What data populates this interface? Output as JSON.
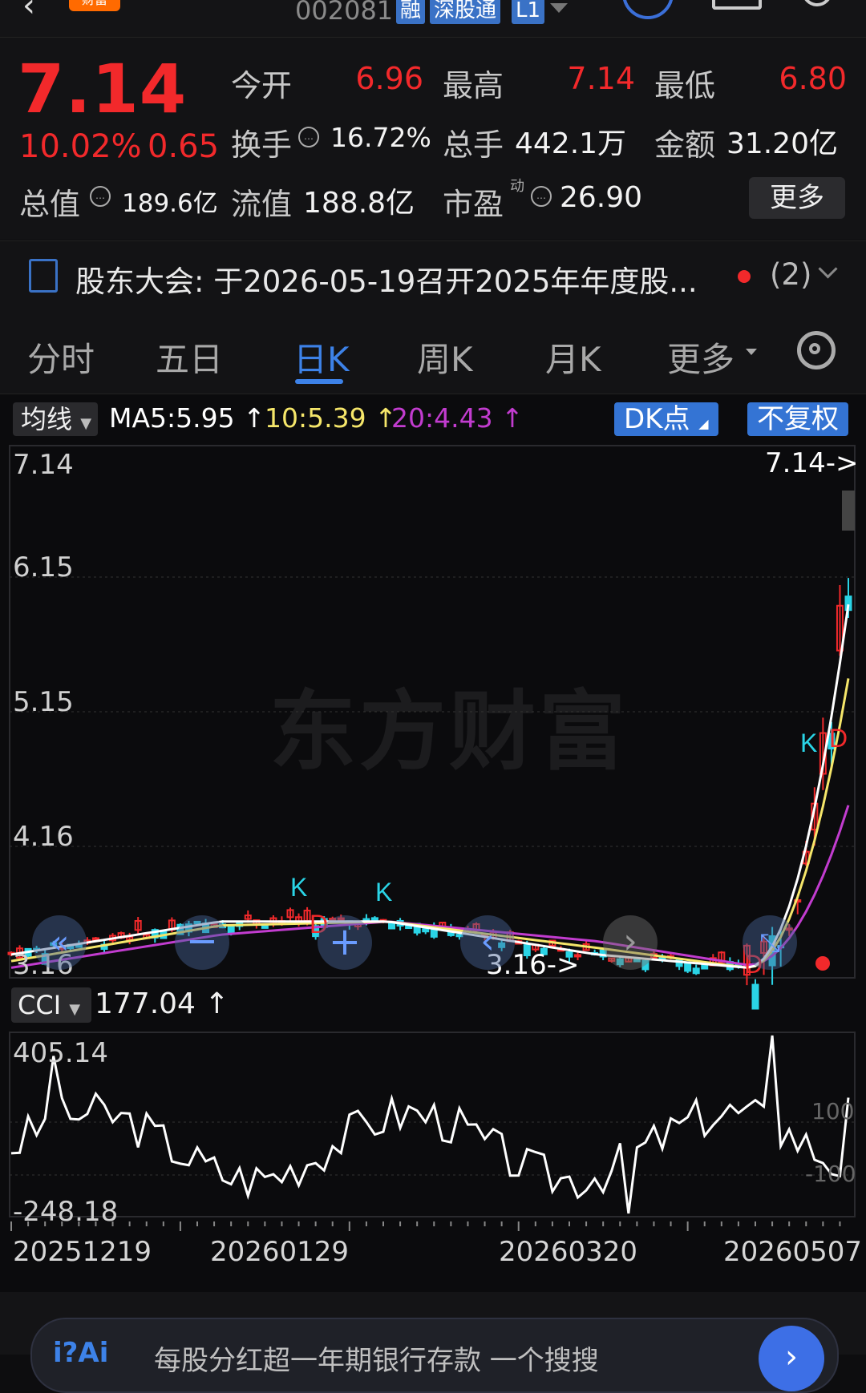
{
  "header": {
    "back": "‹",
    "logo": "财富",
    "code": "002081",
    "badges": [
      "融",
      "深股通",
      "L1"
    ]
  },
  "quote": {
    "price": "7.14",
    "change_pct": "10.02%",
    "change_amt": "0.65",
    "open_label": "今开",
    "open": "6.96",
    "high_label": "最高",
    "high": "7.14",
    "low_label": "最低",
    "low": "6.80",
    "turnover_label": "换手",
    "turnover": "16.72%",
    "volume_label": "总手",
    "volume": "442.1万",
    "amount_label": "金额",
    "amount": "31.20亿",
    "mktcap_label": "总值",
    "mktcap": "189.6亿",
    "float_label": "流值",
    "float": "188.8亿",
    "pe_label": "市盈",
    "pe_sup": "动",
    "pe": "26.90",
    "more": "更多"
  },
  "notice": {
    "text": "股东大会:  于2026-05-19召开2025年年度股...",
    "count": "(2)"
  },
  "tabs": [
    "分时",
    "五日",
    "日K",
    "周K",
    "月K",
    "更多"
  ],
  "chart": {
    "indicator_select": "均线",
    "ma5": "MA5:5.95",
    "ma10": "10:5.39",
    "ma20": "20:4.43",
    "dk_button": "DK点",
    "adjust_button": "不复权",
    "y_ticks": [
      "7.14",
      "6.15",
      "5.15",
      "4.16",
      "3.16"
    ],
    "high_marker": "7.14->",
    "low_marker": "3.16->",
    "watermark": "东方财富",
    "cci_select": "CCI",
    "cci_value": "177.04",
    "cci_ticks": [
      "405.14",
      "-248.18",
      "100",
      "-100"
    ],
    "dates": [
      "20251219",
      "20260129",
      "20260320",
      "20260507"
    ],
    "colors": {
      "up": "#f2292b",
      "down": "#2ad4e6",
      "ma5": "#ffffff",
      "ma10": "#f5e66a",
      "ma20": "#c23ccf"
    }
  },
  "bottom_bar": {
    "logo": "i?Ai",
    "text": "每股分红超一年期银行存款  一个搜搜"
  },
  "chart_data": {
    "type": "line",
    "title": "",
    "x": [
      "20251219",
      "20260129",
      "20260320",
      "20260507"
    ],
    "ylim": [
      3.16,
      7.14
    ],
    "series": [
      {
        "name": "MA5",
        "values": [
          3.3,
          3.55,
          3.55,
          3.3,
          3.2,
          5.95
        ]
      },
      {
        "name": "10",
        "values": [
          3.25,
          3.52,
          3.55,
          3.35,
          3.2,
          5.39
        ]
      },
      {
        "name": "20",
        "values": [
          3.2,
          3.45,
          3.55,
          3.4,
          3.22,
          4.43
        ]
      }
    ],
    "cci": {
      "name": "CCI",
      "last": 177.04,
      "ylim": [
        -248.18,
        405.14
      ],
      "levels": [
        100,
        -100
      ]
    }
  }
}
